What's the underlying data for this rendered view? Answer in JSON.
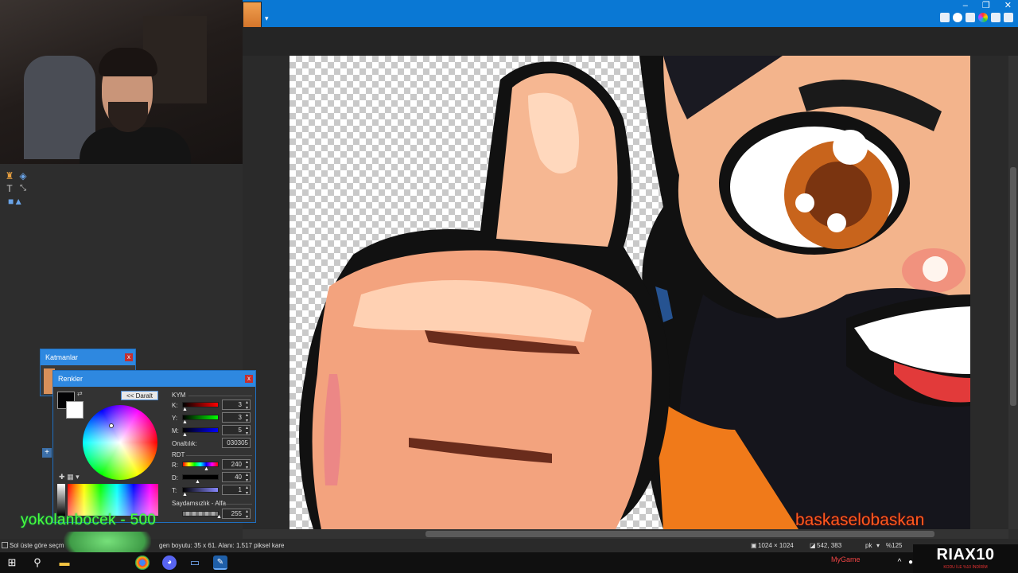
{
  "titlebar": {
    "window_controls": [
      "–",
      "❐",
      "✕"
    ],
    "icons": [
      "tools-icon",
      "palette-icon",
      "layers-icon",
      "colors-icon",
      "settings-icon",
      "help-icon"
    ]
  },
  "layers_panel": {
    "title": "Katmanlar",
    "close": "x"
  },
  "colors_panel": {
    "title": "Renkler",
    "close": "x",
    "collapse_button": "<< Daralt",
    "primary_color": "#030305",
    "secondary_color": "#ffffff",
    "kym_label": "KYM",
    "k_label": "K:",
    "k_value": "3",
    "y_label": "Y:",
    "y_value": "3",
    "m_label": "M:",
    "m_value": "5",
    "hex_label": "Onaltılık:",
    "hex_value": "030305",
    "rdt_label": "RDT",
    "r_label": "R:",
    "r_value": "240",
    "d_label": "D:",
    "d_value": "40",
    "t_label": "T:",
    "t_value": "1",
    "alpha_label": "Saydamsızlık - Alfa",
    "alpha_value": "255"
  },
  "overlays": {
    "chat_left": "yokolanbocek - 500",
    "chat_right": "baskaselobaskan"
  },
  "statusbar": {
    "left_text": "Sol üste göre seçm",
    "selection_text": "gen boyutu: 35 x 61. Alanı: 1.517 piksel kare",
    "image_size": "1024 × 1024",
    "cursor_pos": "542, 383",
    "unit": "pk",
    "zoom": "%125"
  },
  "sponsor": {
    "text": "MyGame"
  },
  "riax": {
    "title": "RIAX10",
    "subtitle": "KODU İLE %10 İNDİRİM"
  }
}
